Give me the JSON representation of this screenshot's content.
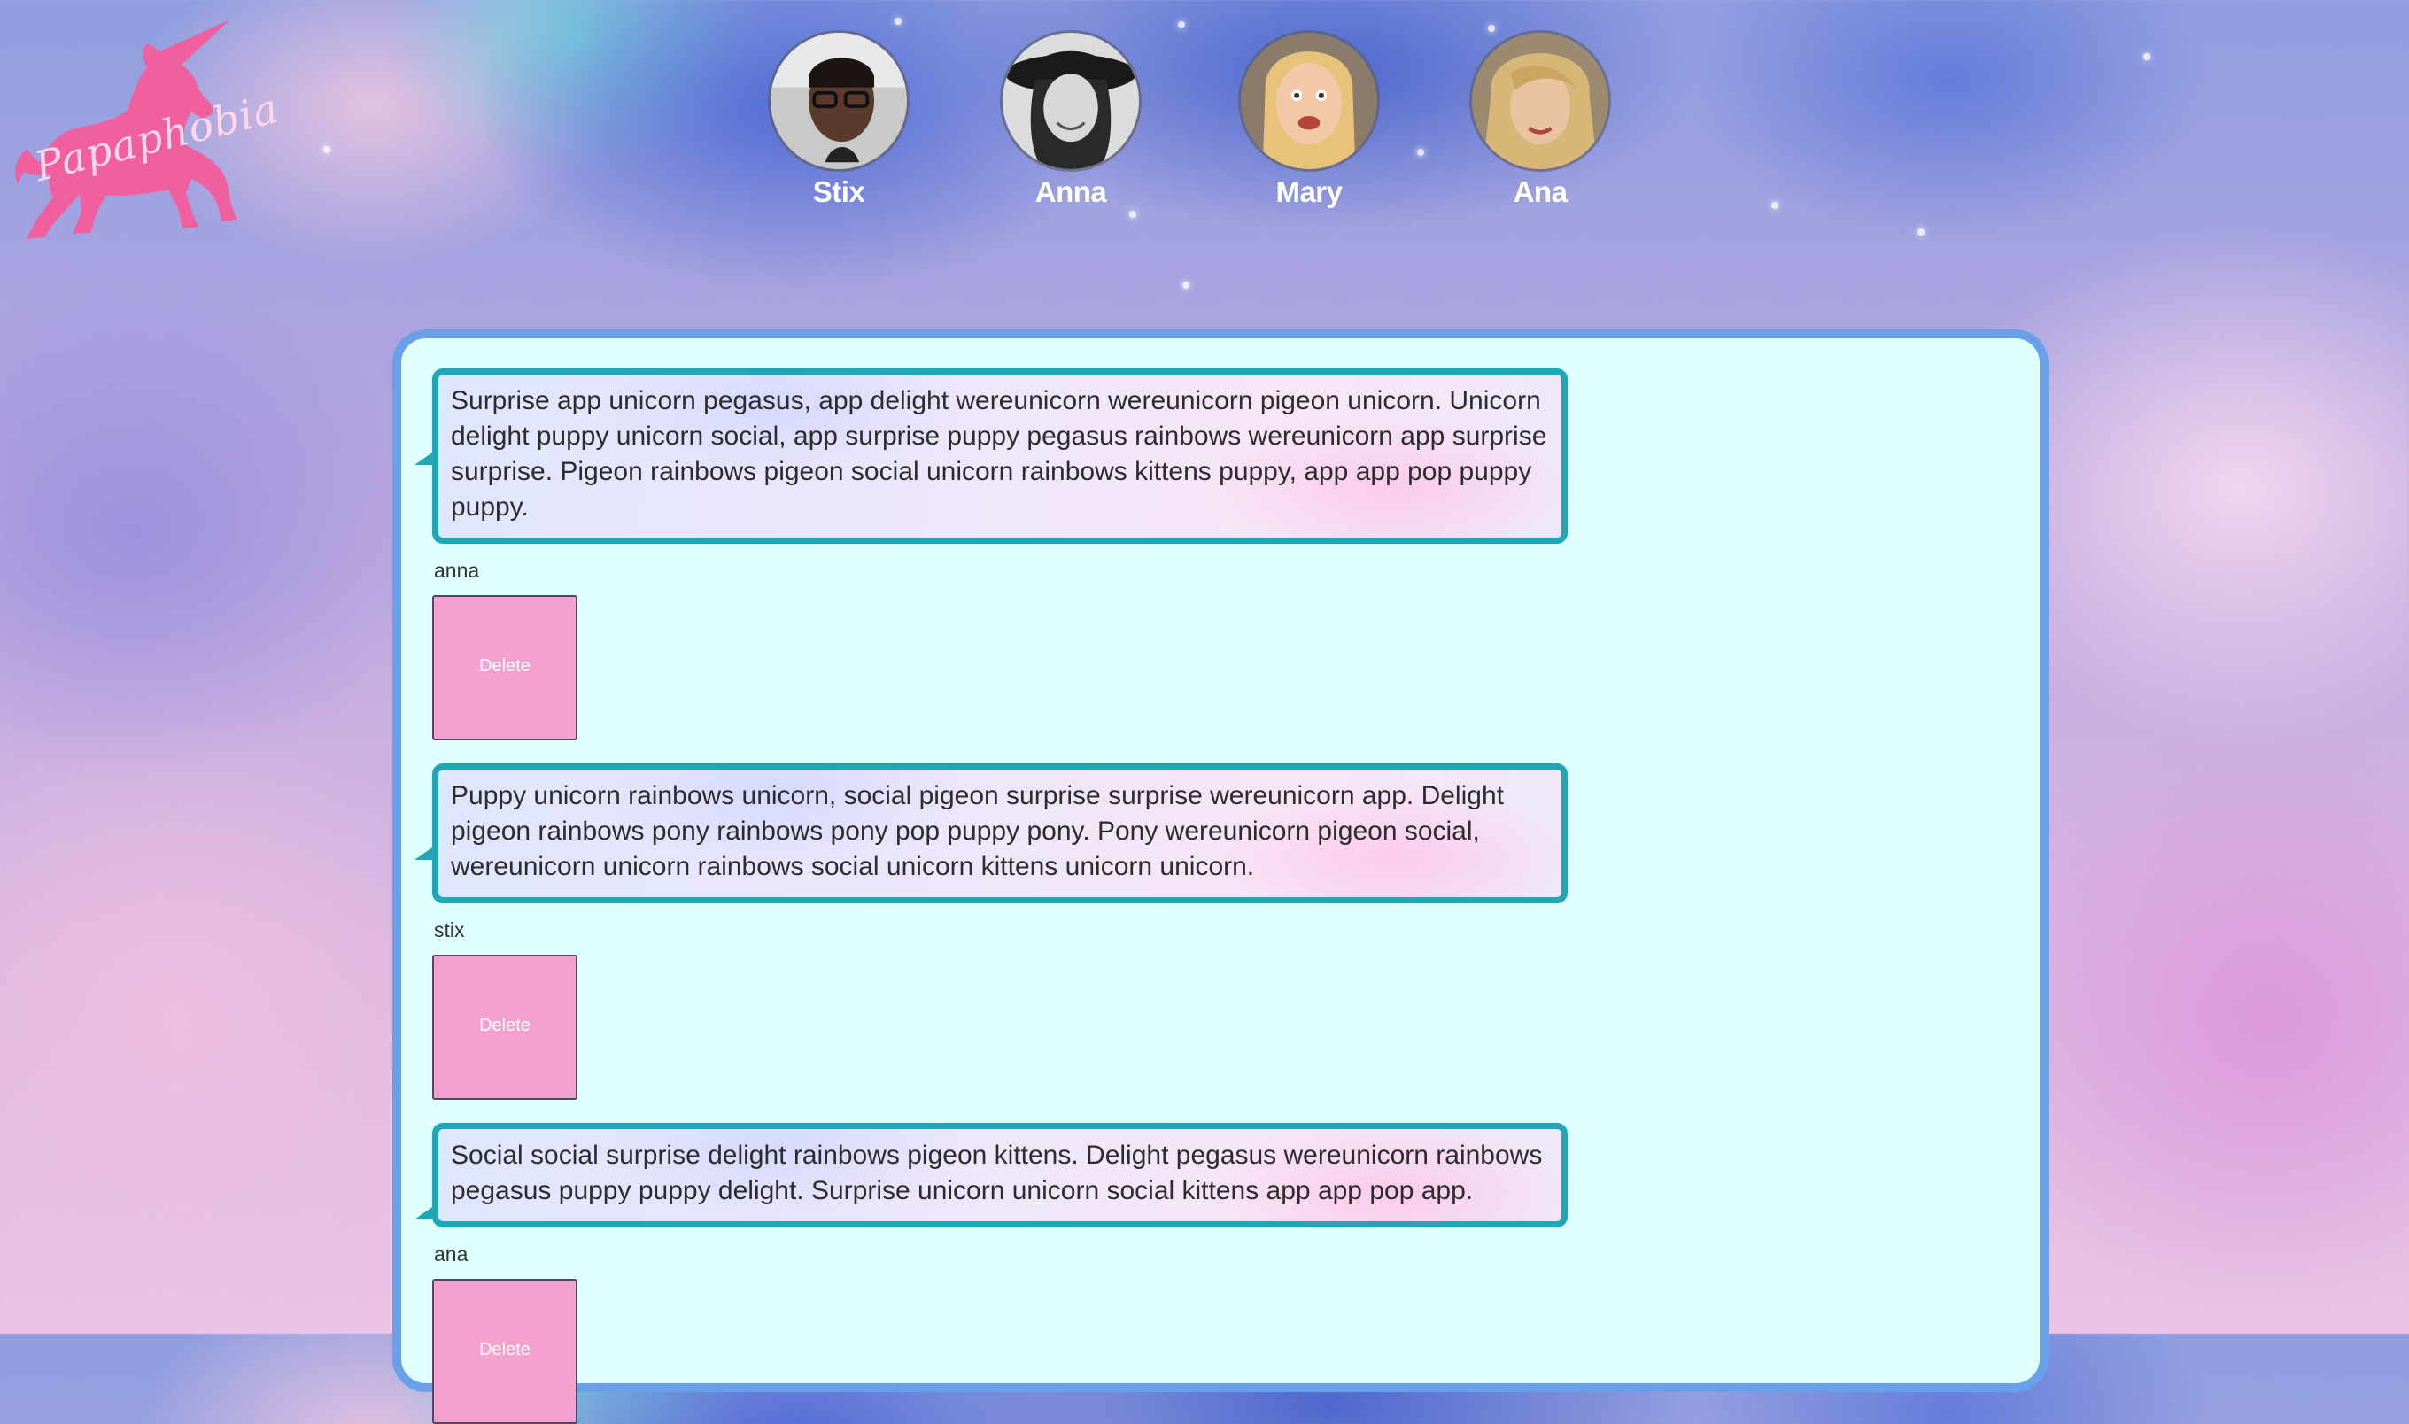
{
  "brand": {
    "logo_text": "Papaphobia",
    "logo_color": "#f0609e"
  },
  "users": [
    {
      "name": "Stix"
    },
    {
      "name": "Anna"
    },
    {
      "name": "Mary"
    },
    {
      "name": "Ana"
    }
  ],
  "messages": [
    {
      "text": "Surprise app unicorn pegasus, app delight wereunicorn wereunicorn pigeon unicorn. Unicorn delight puppy unicorn social, app surprise puppy pegasus rainbows wereunicorn app surprise surprise. Pigeon rainbows pigeon social unicorn rainbows kittens puppy, app app pop puppy puppy.",
      "author": "anna",
      "delete_label": "Delete"
    },
    {
      "text": "Puppy unicorn rainbows unicorn, social pigeon surprise surprise wereunicorn app. Delight pigeon rainbows pony rainbows pony pop puppy pony. Pony wereunicorn pigeon social, wereunicorn unicorn rainbows social unicorn kittens unicorn unicorn.",
      "author": "stix",
      "delete_label": "Delete"
    },
    {
      "text": "Social social surprise delight rainbows pigeon kittens. Delight pegasus wereunicorn rainbows pegasus puppy puppy delight. Surprise unicorn unicorn social kittens app app pop app.",
      "author": "ana",
      "delete_label": "Delete"
    }
  ],
  "colors": {
    "panel_bg": "#e0ffff",
    "panel_border": "#6aa0ea",
    "bubble_border": "#1fa7b5",
    "delete_bg": "#f4a1d0"
  }
}
